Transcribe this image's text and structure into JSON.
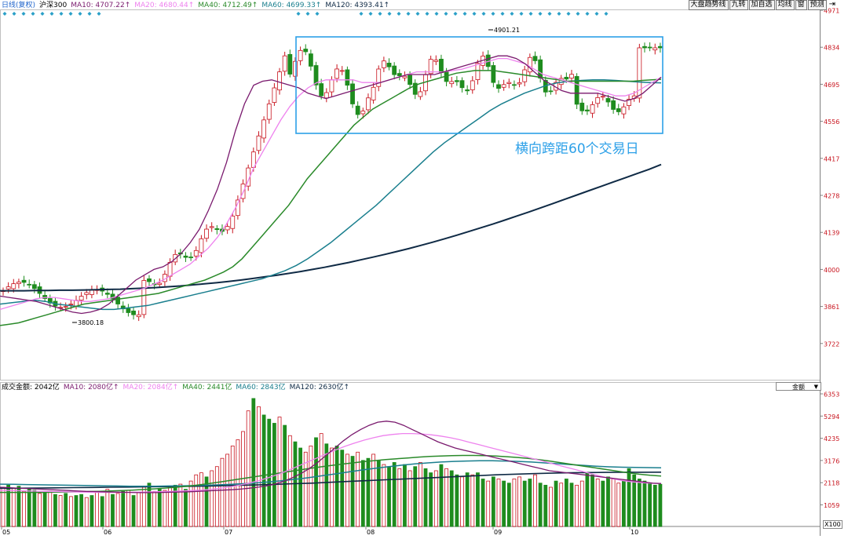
{
  "toolbar": {
    "buttons": [
      "大盘趋势线",
      "九转",
      "加自选",
      "均线",
      "窗",
      "预测"
    ]
  },
  "price_legend": {
    "period": "日线(复权)",
    "index": "沪深300",
    "ma10": "MA10: 4707.22↑",
    "ma20": "MA20: 4680.44↑",
    "ma40": "MA40: 4712.49↑",
    "ma60": "MA60: 4699.33↑",
    "ma120": "MA120: 4393.41↑"
  },
  "volume_legend": {
    "amount": "成交金额: 2042亿",
    "ma10": "MA10: 2080亿↑",
    "ma20": "MA20: 2084亿↑",
    "ma40": "MA40: 2441亿",
    "ma60": "MA60: 2843亿",
    "ma120": "MA120: 2630亿↑"
  },
  "dropdown": {
    "label": "金额"
  },
  "volume_unit": "X100",
  "annotation": {
    "text": "横向跨距60个交易日"
  },
  "colors": {
    "up": "#c8141e",
    "down": "#1e8c1e",
    "axis_text": "#c8141e",
    "ma10": "#7a1a6e",
    "ma20": "#ee82ee",
    "ma40": "#2a8a2a",
    "ma60": "#1a7f8e",
    "ma120": "#0f2a45",
    "box": "#2ca0e8",
    "dots": "#2aa0c8"
  },
  "chart_data": [
    {
      "type": "candlestick",
      "yticks": [
        "4971",
        "4834",
        "4695",
        "4556",
        "4417",
        "4278",
        "4139",
        "4000",
        "3861",
        "3722"
      ],
      "xticks": [
        "05",
        "06",
        "07",
        "08",
        "09",
        "10"
      ],
      "ylim": [
        3600,
        5000
      ],
      "low_label": "3800.18",
      "high_label": "4901.21",
      "ma10_y": [
        3900,
        3895,
        3890,
        3885,
        3880,
        3870,
        3860,
        3850,
        3840,
        3835,
        3840,
        3850,
        3870,
        3900,
        3930,
        3960,
        3980,
        4000,
        4010,
        4030,
        4060,
        4100,
        4150,
        4220,
        4300,
        4400,
        4520,
        4620,
        4690,
        4705,
        4710,
        4700,
        4690,
        4680,
        4660,
        4650,
        4640,
        4650,
        4660,
        4670,
        4680,
        4690,
        4700,
        4710,
        4720,
        4730,
        4730,
        4730,
        4730,
        4740,
        4750,
        4760,
        4770,
        4780,
        4790,
        4800,
        4800,
        4790,
        4770,
        4740,
        4710,
        4690,
        4670,
        4660,
        4660,
        4660,
        4660,
        4650,
        4640,
        4630,
        4640,
        4660,
        4690,
        4720
      ],
      "ma20_y": [
        3850,
        3860,
        3870,
        3880,
        3890,
        3895,
        3895,
        3890,
        3885,
        3880,
        3880,
        3885,
        3890,
        3900,
        3910,
        3920,
        3930,
        3945,
        3960,
        3980,
        4000,
        4020,
        4050,
        4080,
        4120,
        4170,
        4230,
        4300,
        4380,
        4440,
        4500,
        4560,
        4610,
        4650,
        4680,
        4700,
        4710,
        4710,
        4710,
        4710,
        4700,
        4700,
        4700,
        4710,
        4720,
        4730,
        4740,
        4740,
        4740,
        4740,
        4745,
        4750,
        4760,
        4770,
        4780,
        4790,
        4790,
        4780,
        4770,
        4750,
        4730,
        4720,
        4710,
        4700,
        4690,
        4680,
        4670,
        4660,
        4650,
        4650,
        4660,
        4680,
        4700,
        4720
      ],
      "ma40_y": [
        3790,
        3795,
        3800,
        3810,
        3820,
        3830,
        3840,
        3850,
        3860,
        3870,
        3875,
        3880,
        3885,
        3890,
        3895,
        3900,
        3905,
        3910,
        3920,
        3930,
        3940,
        3950,
        3960,
        3975,
        3990,
        4010,
        4040,
        4080,
        4120,
        4160,
        4200,
        4240,
        4290,
        4340,
        4380,
        4420,
        4460,
        4500,
        4540,
        4570,
        4600,
        4620,
        4640,
        4660,
        4680,
        4695,
        4705,
        4715,
        4725,
        4735,
        4740,
        4745,
        4745,
        4745,
        4740,
        4735,
        4730,
        4725,
        4720,
        4715,
        4710,
        4705,
        4705,
        4705,
        4705,
        4705,
        4705,
        4705,
        4705,
        4708,
        4710,
        4712
      ],
      "ma60_y": [
        3870,
        3875,
        3880,
        3885,
        3880,
        3870,
        3865,
        3860,
        3855,
        3850,
        3850,
        3855,
        3860,
        3865,
        3875,
        3885,
        3895,
        3905,
        3915,
        3925,
        3935,
        3945,
        3955,
        3965,
        3980,
        3995,
        4015,
        4040,
        4070,
        4100,
        4135,
        4170,
        4205,
        4240,
        4280,
        4320,
        4360,
        4400,
        4440,
        4475,
        4505,
        4535,
        4565,
        4595,
        4620,
        4640,
        4660,
        4675,
        4690,
        4700,
        4705,
        4708,
        4710,
        4710,
        4708,
        4705,
        4702,
        4700,
        4699
      ],
      "ma120_y": [
        3920,
        3920,
        3920,
        3921,
        3921,
        3922,
        3922,
        3923,
        3924,
        3925,
        3926,
        3928,
        3930,
        3932,
        3935,
        3938,
        3942,
        3946,
        3950,
        3955,
        3960,
        3966,
        3972,
        3978,
        3985,
        3992,
        4000,
        4008,
        4017,
        4026,
        4036,
        4046,
        4056,
        4067,
        4078,
        4090,
        4102,
        4115,
        4128,
        4142,
        4156,
        4170,
        4185,
        4200,
        4215,
        4231,
        4247,
        4263,
        4279,
        4295,
        4311,
        4327,
        4343,
        4359,
        4375,
        4393
      ]
    },
    {
      "type": "bar",
      "yticks": [
        "6353",
        "5294",
        "4235",
        "3176",
        "2118",
        "1059"
      ],
      "ylim": [
        0,
        6500
      ],
      "values": [
        1900,
        2000,
        1850,
        1950,
        1700,
        1800,
        1750,
        1600,
        1650,
        1700,
        1550,
        1500,
        1600,
        1450,
        1500,
        1550,
        1400,
        1500,
        1650,
        1450,
        1800,
        1550,
        1600,
        1700,
        1750,
        1500,
        1650,
        1900,
        2100,
        1700,
        1850,
        1750,
        1900,
        2000,
        2050,
        1800,
        2200,
        2500,
        2600,
        2400,
        2700,
        2900,
        3300,
        3500,
        3900,
        4200,
        4600,
        5600,
        6200,
        5800,
        5400,
        5200,
        5000,
        5300,
        4900,
        4400,
        4100,
        3800,
        3600,
        3900,
        4300,
        4500,
        4000,
        3800,
        3900,
        3700,
        3500,
        3400,
        3600,
        3200,
        3300,
        3500,
        3200,
        3000,
        2900,
        3100,
        2800,
        3000,
        2700,
        2900,
        3100,
        2800,
        2600,
        2700,
        3000,
        2800,
        2700,
        2500,
        2400,
        2600,
        2500,
        2600,
        2300,
        2200,
        2400,
        2300,
        2200,
        2100,
        2300,
        2400,
        2200,
        2300,
        2500,
        2100,
        2000,
        1900,
        2200,
        2100,
        2300,
        2100,
        2000,
        2200,
        2600,
        2500,
        2300,
        2200,
        2400,
        2300,
        2100,
        2200,
        2800,
        2500,
        2300,
        2200,
        2100,
        2000,
        2042
      ],
      "colors_up": [
        1,
        0,
        1,
        0,
        1,
        0,
        0,
        1,
        0,
        1,
        0,
        1,
        0,
        1,
        0,
        0,
        1,
        0,
        1,
        0,
        1,
        0,
        1,
        0,
        1,
        0,
        1,
        1,
        0,
        1,
        0,
        1,
        1,
        0,
        1,
        0,
        1,
        1,
        1,
        0,
        1,
        1,
        1,
        1,
        1,
        1,
        1,
        1,
        0,
        1,
        0,
        0,
        0,
        1,
        0,
        1,
        0,
        0,
        1,
        1,
        0,
        1,
        0,
        1,
        0,
        0,
        1,
        0,
        1,
        0,
        0,
        1,
        0,
        1,
        0,
        0,
        1,
        0,
        1,
        0,
        1,
        0,
        0,
        1,
        0,
        1,
        0,
        0,
        1,
        0,
        1,
        0,
        0,
        1,
        0,
        1,
        0,
        0,
        1,
        1,
        0,
        0,
        1,
        0,
        0,
        1,
        0,
        1,
        0,
        0,
        1,
        1,
        0,
        0,
        1,
        0,
        0,
        1,
        1,
        0,
        0,
        0,
        0,
        0,
        0,
        0
      ],
      "ma10": [
        1900,
        1880,
        1860,
        1840,
        1820,
        1800,
        1780,
        1760,
        1740,
        1720,
        1700,
        1690,
        1680,
        1670,
        1660,
        1650,
        1640,
        1640,
        1640,
        1650,
        1660,
        1670,
        1680,
        1700,
        1720,
        1740,
        1760,
        1780,
        1810,
        1850,
        1900,
        1960,
        2050,
        2180,
        2350,
        2550,
        2800,
        3100,
        3450,
        3800,
        4150,
        4450,
        4700,
        4900,
        5050,
        5100,
        5050,
        4900,
        4700,
        4500,
        4300,
        4100,
        3950,
        3800,
        3700,
        3600,
        3500,
        3400,
        3300,
        3200,
        3100,
        3000,
        2900,
        2800,
        2700,
        2650,
        2600,
        2550,
        2500,
        2450,
        2400,
        2350,
        2300,
        2250,
        2200,
        2150,
        2100,
        2080
      ],
      "ma20": [
        1750,
        1740,
        1730,
        1720,
        1710,
        1700,
        1690,
        1680,
        1670,
        1660,
        1650,
        1650,
        1650,
        1650,
        1660,
        1670,
        1680,
        1690,
        1700,
        1720,
        1740,
        1760,
        1800,
        1850,
        1920,
        2000,
        2100,
        2220,
        2360,
        2520,
        2700,
        2900,
        3100,
        3300,
        3500,
        3700,
        3880,
        4040,
        4180,
        4300,
        4400,
        4460,
        4500,
        4500,
        4480,
        4440,
        4380,
        4300,
        4200,
        4080,
        3960,
        3840,
        3720,
        3600,
        3480,
        3360,
        3240,
        3120,
        3000,
        2880,
        2760,
        2640,
        2520,
        2400,
        2300,
        2220,
        2160,
        2120,
        2090,
        2084
      ],
      "ma40": [
        1650,
        1650,
        1650,
        1650,
        1650,
        1660,
        1670,
        1680,
        1690,
        1700,
        1720,
        1740,
        1760,
        1790,
        1820,
        1860,
        1900,
        1950,
        2010,
        2080,
        2160,
        2240,
        2320,
        2400,
        2480,
        2560,
        2640,
        2720,
        2800,
        2880,
        2950,
        3020,
        3080,
        3140,
        3190,
        3240,
        3280,
        3320,
        3360,
        3390,
        3410,
        3430,
        3440,
        3440,
        3430,
        3410,
        3380,
        3340,
        3290,
        3230,
        3160,
        3080,
        3000,
        2920,
        2840,
        2760,
        2680,
        2600,
        2530,
        2480,
        2441
      ],
      "ma60": [
        2050,
        2040,
        2030,
        2020,
        2010,
        2000,
        1990,
        1980,
        1970,
        1960,
        1950,
        1950,
        1950,
        1960,
        1970,
        1980,
        2000,
        2020,
        2050,
        2080,
        2120,
        2170,
        2230,
        2300,
        2380,
        2470,
        2560,
        2650,
        2740,
        2820,
        2900,
        2970,
        3030,
        3080,
        3120,
        3150,
        3170,
        3180,
        3180,
        3170,
        3150,
        3120,
        3080,
        3040,
        3000,
        2960,
        2920,
        2890,
        2870,
        2860,
        2850,
        2843
      ],
      "ma120": [
        1850,
        1850,
        1860,
        1870,
        1880,
        1890,
        1900,
        1910,
        1920,
        1930,
        1940,
        1950,
        1970,
        1990,
        2010,
        2040,
        2070,
        2100,
        2140,
        2180,
        2220,
        2260,
        2300,
        2340,
        2380,
        2420,
        2460,
        2500,
        2530,
        2560,
        2580,
        2600,
        2610,
        2620,
        2625,
        2628,
        2630
      ]
    }
  ]
}
